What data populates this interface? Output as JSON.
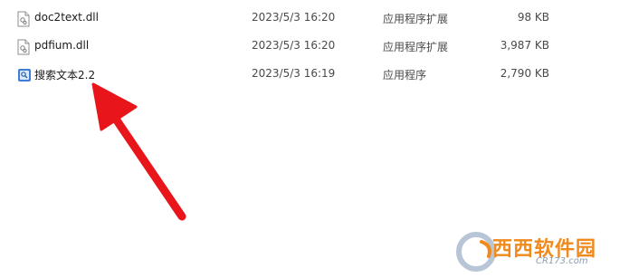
{
  "files": [
    {
      "name": "doc2text.dll",
      "modified": "2023/5/3 16:20",
      "type": "应用程序扩展",
      "size": "98 KB",
      "icon": "dll-file-icon"
    },
    {
      "name": "pdfium.dll",
      "modified": "2023/5/3 16:20",
      "type": "应用程序扩展",
      "size": "3,987 KB",
      "icon": "dll-file-icon"
    },
    {
      "name": "搜索文本2.2",
      "modified": "2023/5/3 16:19",
      "type": "应用程序",
      "size": "2,790 KB",
      "icon": "application-exe-icon"
    }
  ],
  "annotation": {
    "arrow_color": "#e8151b",
    "points_to": "搜索文本2.2"
  },
  "watermark": {
    "brand": "西西软件园",
    "site": "CR173.com",
    "brand_color": "#f08a1c"
  }
}
